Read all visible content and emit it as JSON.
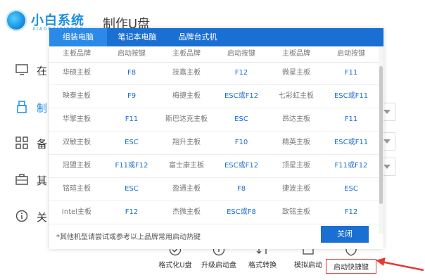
{
  "app": {
    "logo_text": "小白系统",
    "logo_sub": "XIAOBAIXITONG",
    "page_title": "制作U盘"
  },
  "sidebar": {
    "items": [
      {
        "label": "在",
        "icon": "monitor-icon"
      },
      {
        "label": "制",
        "icon": "usb-icon"
      },
      {
        "label": "备",
        "icon": "grid-icon"
      },
      {
        "label": "其",
        "icon": "toolbox-icon"
      },
      {
        "label": "关",
        "icon": "info-icon"
      }
    ]
  },
  "toolbar": {
    "items": [
      {
        "label": "格式化U盘",
        "icon": "check-circle-icon"
      },
      {
        "label": "升级启动盘",
        "icon": "upgrade-icon"
      },
      {
        "label": "格式转换",
        "icon": "convert-icon"
      },
      {
        "label": "模拟启动",
        "icon": "simulate-icon"
      },
      {
        "label": "启动快捷键",
        "icon": "shield-icon"
      }
    ]
  },
  "modal": {
    "tabs": [
      "组装电脑",
      "笔记本电脑",
      "品牌台式机"
    ],
    "active_tab": 0,
    "headers": [
      "主板品牌",
      "启动按键",
      "主板品牌",
      "启动按键",
      "主板品牌",
      "启动按键"
    ],
    "rows": [
      [
        "华硕主板",
        "F8",
        "技嘉主板",
        "F12",
        "微星主板",
        "F11"
      ],
      [
        "映泰主板",
        "F9",
        "梅捷主板",
        "ESC或F12",
        "七彩虹主板",
        "ESC或F11"
      ],
      [
        "华擎主板",
        "F11",
        "斯巴达克主板",
        "ESC",
        "昂达主板",
        "F11"
      ],
      [
        "双敏主板",
        "ESC",
        "翔升主板",
        "F10",
        "精英主板",
        "ESC或F11"
      ],
      [
        "冠盟主板",
        "F11或F12",
        "富士康主板",
        "ESC或F12",
        "顶星主板",
        "F11或F12"
      ],
      [
        "铭瑄主板",
        "ESC",
        "盈通主板",
        "F8",
        "捷波主板",
        "ESC"
      ],
      [
        "Intel主板",
        "F12",
        "杰微主板",
        "ESC或F8",
        "致铭主板",
        "F12"
      ]
    ],
    "footer_note": "*其他机型请尝试或参考以上品牌常用启动热键",
    "close_label": "关闭"
  },
  "colors": {
    "accent": "#1a6fd2",
    "tab_active": "#2b8ae8",
    "arrow": "#e53935"
  }
}
